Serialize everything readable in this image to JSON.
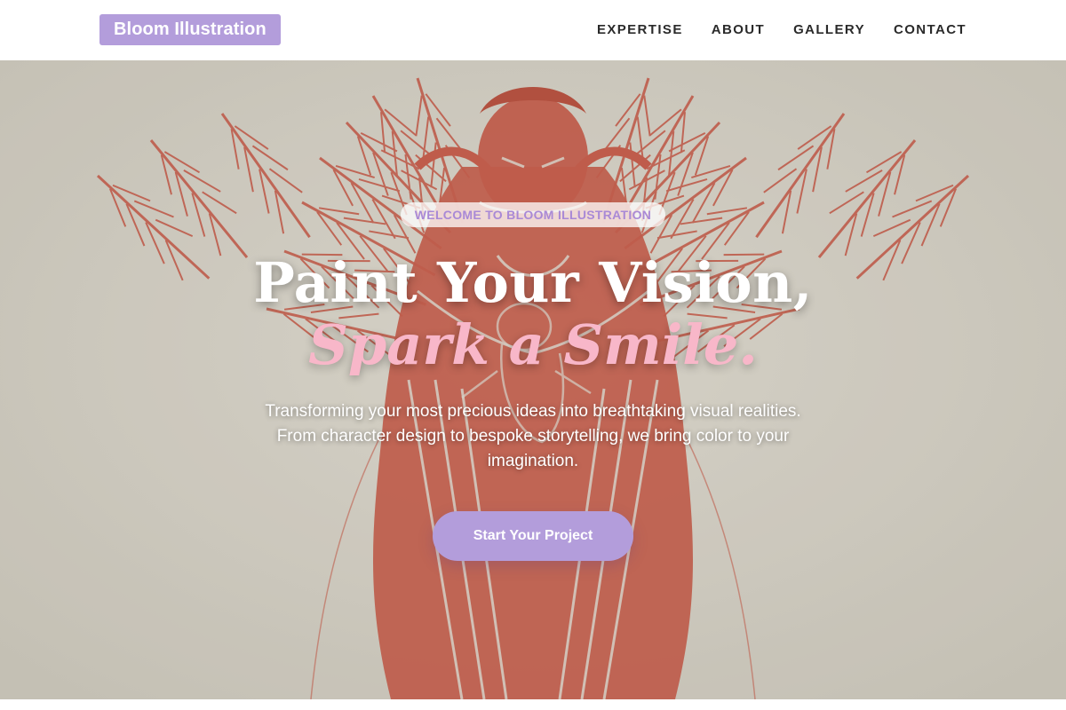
{
  "header": {
    "brand": "Bloom Illustration",
    "nav": [
      {
        "label": "EXPERTISE"
      },
      {
        "label": "ABOUT"
      },
      {
        "label": "GALLERY"
      },
      {
        "label": "CONTACT"
      }
    ]
  },
  "hero": {
    "eyebrow": "WELCOME TO BLOOM ILLUSTRATION",
    "headline_line1": "Paint Your Vision,",
    "headline_line2": "Spark a Smile.",
    "subtitle": "Transforming your most precious ideas into breathtaking visual realities. From character design to bespoke storytelling, we bring color to your imagination.",
    "cta_label": "Start Your Project",
    "background_art": "red-linocut-angel-illustration"
  },
  "colors": {
    "brand_accent": "#b39ddb",
    "headline_accent": "#f8b7c9",
    "art_red": "#c8503e",
    "art_paper": "#dcd7cc"
  }
}
